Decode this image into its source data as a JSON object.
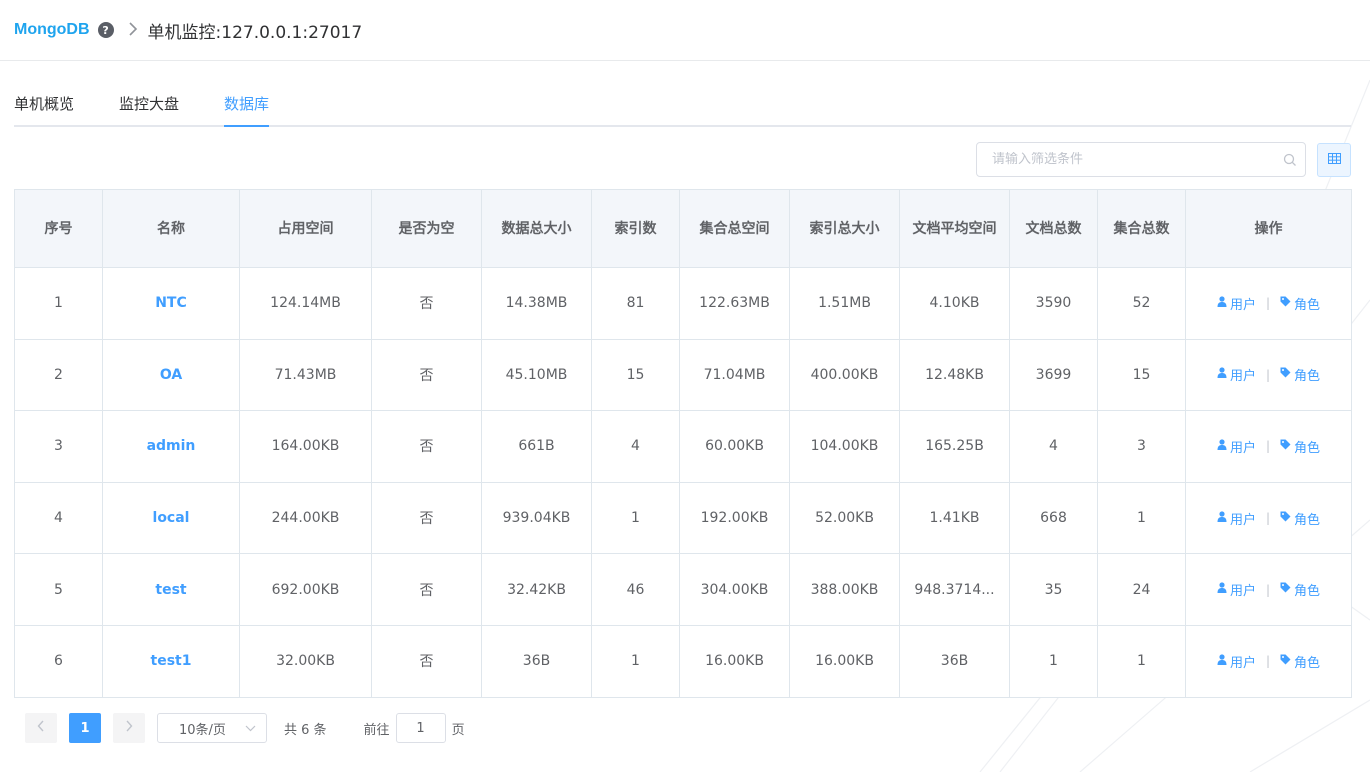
{
  "header": {
    "brand": "MongoDB",
    "help_icon": "question-circle-icon",
    "separator_icon": "chevron-right-icon",
    "title": "单机监控:127.0.0.1:27017"
  },
  "tabs": [
    {
      "label": "单机概览",
      "active": false
    },
    {
      "label": "监控大盘",
      "active": false
    },
    {
      "label": "数据库",
      "active": true
    }
  ],
  "search": {
    "placeholder": "请输入筛选条件",
    "value": "",
    "icon": "search-icon"
  },
  "toolbar": {
    "grid_icon": "table-grid-icon"
  },
  "table": {
    "columns": [
      "序号",
      "名称",
      "占用空间",
      "是否为空",
      "数据总大小",
      "索引数",
      "集合总空间",
      "索引总大小",
      "文档平均空间",
      "文档总数",
      "集合总数",
      "操作"
    ],
    "rows": [
      [
        "1",
        "NTC",
        "124.14MB",
        "否",
        "14.38MB",
        "81",
        "122.63MB",
        "1.51MB",
        "4.10KB",
        "3590",
        "52"
      ],
      [
        "2",
        "OA",
        "71.43MB",
        "否",
        "45.10MB",
        "15",
        "71.04MB",
        "400.00KB",
        "12.48KB",
        "3699",
        "15"
      ],
      [
        "3",
        "admin",
        "164.00KB",
        "否",
        "661B",
        "4",
        "60.00KB",
        "104.00KB",
        "165.25B",
        "4",
        "3"
      ],
      [
        "4",
        "local",
        "244.00KB",
        "否",
        "939.04KB",
        "1",
        "192.00KB",
        "52.00KB",
        "1.41KB",
        "668",
        "1"
      ],
      [
        "5",
        "test",
        "692.00KB",
        "否",
        "32.42KB",
        "46",
        "304.00KB",
        "388.00KB",
        "948.3714...",
        "35",
        "24"
      ],
      [
        "6",
        "test1",
        "32.00KB",
        "否",
        "36B",
        "1",
        "16.00KB",
        "16.00KB",
        "36B",
        "1",
        "1"
      ]
    ],
    "actions": {
      "user_label": "用户",
      "user_icon": "user-icon",
      "role_label": "角色",
      "role_icon": "tag-icon",
      "divider": "|"
    }
  },
  "pagination": {
    "prev_icon": "chevron-left-icon",
    "current_page": "1",
    "next_icon": "chevron-right-icon",
    "page_size": "10条/页",
    "page_size_icon": "chevron-down-icon",
    "total": "共 6 条",
    "goto_label": "前往",
    "goto_value": "1",
    "goto_suffix": "页"
  },
  "colors": {
    "accent": "#409eff",
    "brand": "#1fa4ee",
    "header_bg": "#f3f6fa",
    "border": "#dfe6ec"
  }
}
